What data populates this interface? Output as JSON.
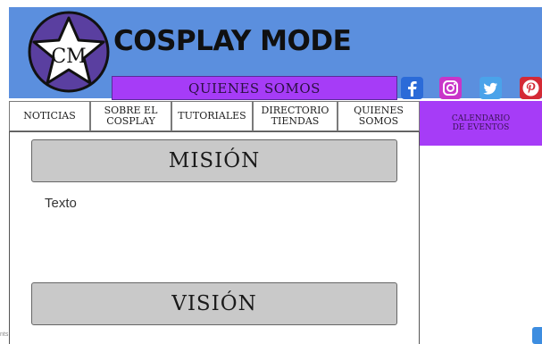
{
  "header": {
    "logo_text": "CM",
    "title": "COSPLAY MODE",
    "section_bar": "QUIENES SOMOS"
  },
  "social": [
    {
      "name": "facebook",
      "icon": "facebook-icon",
      "color": "#2b6bd8"
    },
    {
      "name": "instagram",
      "icon": "instagram-icon",
      "color": "#c935c9"
    },
    {
      "name": "twitter",
      "icon": "twitter-icon",
      "color": "#4aa3ea"
    },
    {
      "name": "pinterest",
      "icon": "pinterest-icon",
      "color": "#d42a36"
    }
  ],
  "nav": {
    "items": [
      {
        "label": "NOTICIAS"
      },
      {
        "label": "SOBRE EL\nCOSPLAY"
      },
      {
        "label": "TUTORIALES"
      },
      {
        "label": "DIRECTORIO\nTIENDAS"
      },
      {
        "label": "QUIENES\nSOMOS"
      }
    ],
    "calendar": "CALENDARIO\nDE EVENTOS"
  },
  "main": {
    "mision_heading": "MISIÓN",
    "mision_text": "Texto",
    "vision_heading": "VISIÓN"
  },
  "footer": {
    "corner_text": "nts"
  },
  "colors": {
    "header_bg": "#5b8fde",
    "accent_purple": "#a63cf7",
    "section_gray": "#c9c9c9"
  }
}
